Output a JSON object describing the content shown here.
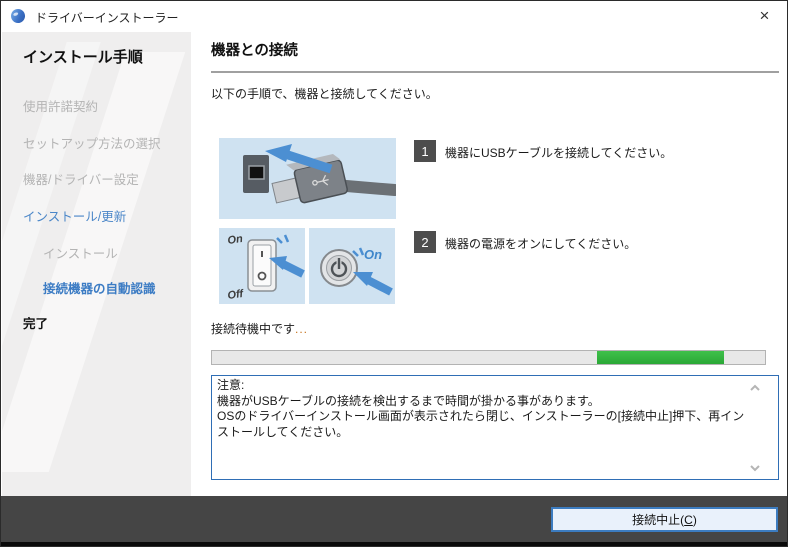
{
  "window": {
    "title": "ドライバーインストーラー",
    "close_glyph": "×"
  },
  "sidebar": {
    "heading": "インストール手順",
    "items": [
      {
        "label": "使用許諾契約",
        "state": "inactive"
      },
      {
        "label": "セットアップ方法の選択",
        "state": "inactive"
      },
      {
        "label": "機器/ドライバー設定",
        "state": "inactive"
      },
      {
        "label": "インストール/更新",
        "state": "active"
      },
      {
        "label": "インストール",
        "state": "inactive-sub"
      },
      {
        "label": "接続機器の自動認識",
        "state": "current-sub"
      },
      {
        "label": "完了",
        "state": "upcoming"
      }
    ]
  },
  "main": {
    "heading": "機器との接続",
    "intro": "以下の手順で、機器と接続してください。",
    "steps": [
      {
        "number": "1",
        "text": "機器にUSBケーブルを接続してください。"
      },
      {
        "number": "2",
        "text": "機器の電源をオンにしてください。"
      }
    ],
    "illustrations": {
      "switch_on_label": "On",
      "switch_off_label": "Off",
      "power_on_label": "On"
    },
    "status_text": "接続待機中です",
    "status_dots": "...",
    "progress": {
      "start_percent": 69.7,
      "width_percent": 22.9,
      "color_note": "#2eb13c"
    },
    "note": "注意:\n機器がUSBケーブルの接続を検出するまで時間が掛かる事があります。\nOSのドライバーインストール画面が表示されたら閉じ、インストーラーの[接続中止]押下、再インストールしてください。"
  },
  "footer": {
    "cancel": {
      "prefix": "接続中止(",
      "mnemonic": "C",
      "suffix": ")"
    }
  },
  "colors": {
    "accent_blue": "#3c7cc4",
    "progress_green": "#2eb13c",
    "illustration_bg": "#cfe2f1",
    "footer_gray": "#454545"
  }
}
